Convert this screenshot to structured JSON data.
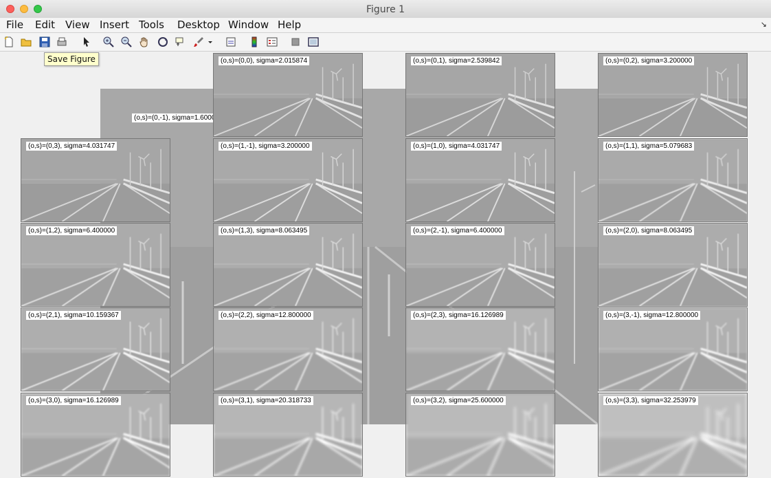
{
  "window": {
    "title": "Figure 1"
  },
  "menu": [
    "File",
    "Edit",
    "View",
    "Insert",
    "Tools",
    "Desktop",
    "Window",
    "Help"
  ],
  "toolbar": {
    "tooltip": "Save Figure",
    "buttons": [
      "new-figure",
      "open-file",
      "save-figure",
      "print-figure",
      "edit-plot",
      "zoom-in",
      "zoom-out",
      "pan",
      "rotate-3d",
      "data-cursor",
      "brush",
      "link-plot",
      "insert-colorbar",
      "insert-legend",
      "hide-plot-tools",
      "show-plot-tools"
    ]
  },
  "background_image": {
    "label": "(o,s)=(0,-1), sigma=1.6000"
  },
  "panels": [
    {
      "label": "(o,s)=(0,0), sigma=2.015874",
      "blur": 0
    },
    {
      "label": "(o,s)=(0,1), sigma=2.539842",
      "blur": 0
    },
    {
      "label": "(o,s)=(0,2), sigma=3.200000",
      "blur": 0
    },
    {
      "label": "(o,s)=(0,3), sigma=4.031747",
      "blur": 0
    },
    {
      "label": "(o,s)=(1,-1), sigma=3.200000",
      "blur": 0.3
    },
    {
      "label": "(o,s)=(1,0), sigma=4.031747",
      "blur": 0.3
    },
    {
      "label": "(o,s)=(1,1), sigma=5.079683",
      "blur": 0.4
    },
    {
      "label": "(o,s)=(1,2), sigma=6.400000",
      "blur": 0.5
    },
    {
      "label": "(o,s)=(1,3), sigma=8.063495",
      "blur": 0.6
    },
    {
      "label": "(o,s)=(2,-1), sigma=6.400000",
      "blur": 0.5
    },
    {
      "label": "(o,s)=(2,0), sigma=8.063495",
      "blur": 0.6
    },
    {
      "label": "(o,s)=(2,1), sigma=10.159367",
      "blur": 0.8
    },
    {
      "label": "(o,s)=(2,2), sigma=12.800000",
      "blur": 1.0
    },
    {
      "label": "(o,s)=(2,3), sigma=16.126989",
      "blur": 1.3
    },
    {
      "label": "(o,s)=(3,-1), sigma=12.800000",
      "blur": 1.0
    },
    {
      "label": "(o,s)=(3,0), sigma=16.126989",
      "blur": 1.3
    },
    {
      "label": "(o,s)=(3,1), sigma=20.318733",
      "blur": 1.7
    },
    {
      "label": "(o,s)=(3,2), sigma=25.600000",
      "blur": 2.1
    },
    {
      "label": "(o,s)=(3,3), sigma=32.253979",
      "blur": 2.6
    }
  ]
}
